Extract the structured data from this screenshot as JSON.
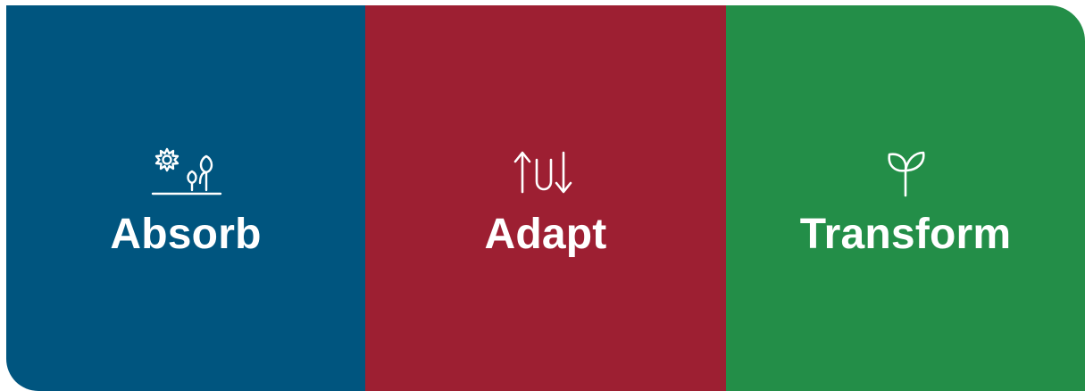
{
  "panels": [
    {
      "label": "Absorb",
      "icon": "flower-and-plants-icon",
      "color": "#00557f"
    },
    {
      "label": "Adapt",
      "icon": "up-down-arrows-icon",
      "color": "#9d1f32"
    },
    {
      "label": "Transform",
      "icon": "sprout-icon",
      "color": "#238e48"
    }
  ]
}
